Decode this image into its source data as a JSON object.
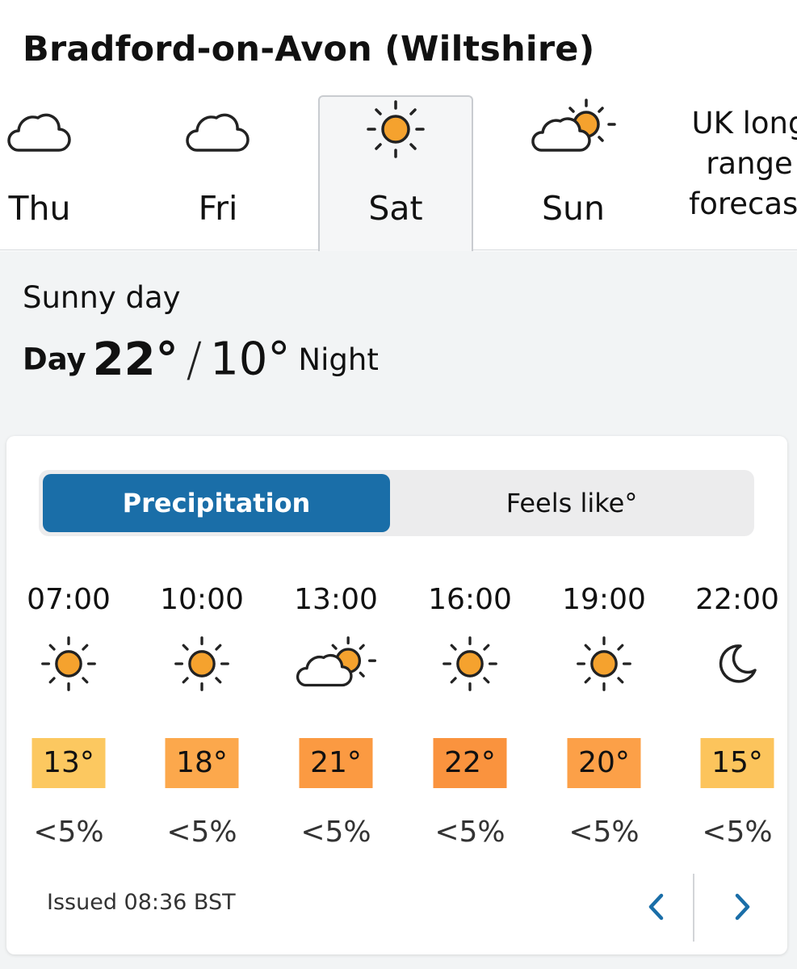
{
  "location": "Bradford-on-Avon (Wiltshire)",
  "days": [
    {
      "label": "Thu",
      "icon": "cloud-icon",
      "selected": false
    },
    {
      "label": "Fri",
      "icon": "cloud-icon",
      "selected": false
    },
    {
      "label": "Sat",
      "icon": "sun-icon",
      "selected": true
    },
    {
      "label": "Sun",
      "icon": "sun-cloud-icon",
      "selected": false
    }
  ],
  "long_range": {
    "line1": "UK long",
    "line2": "range",
    "line3": "forecast"
  },
  "summary": {
    "description": "Sunny day",
    "day_label": "Day",
    "day_temp": "22°",
    "separator": "/",
    "night_temp": "10°",
    "night_label": "Night"
  },
  "toggle": {
    "precipitation": "Precipitation",
    "feels_like": "Feels like°",
    "active": "precipitation"
  },
  "hours": [
    {
      "time": "07:00",
      "icon": "sun-icon",
      "temp": "13°",
      "temp_color": "#fcc860",
      "precip": "<5%"
    },
    {
      "time": "10:00",
      "icon": "sun-icon",
      "temp": "18°",
      "temp_color": "#fca84c",
      "precip": "<5%"
    },
    {
      "time": "13:00",
      "icon": "sun-cloud-icon",
      "temp": "21°",
      "temp_color": "#fb9a42",
      "precip": "<5%"
    },
    {
      "time": "16:00",
      "icon": "sun-icon",
      "temp": "22°",
      "temp_color": "#fa933e",
      "precip": "<5%"
    },
    {
      "time": "19:00",
      "icon": "sun-icon",
      "temp": "20°",
      "temp_color": "#fca048",
      "precip": "<5%"
    },
    {
      "time": "22:00",
      "icon": "moon-icon",
      "temp": "15°",
      "temp_color": "#fcc45c",
      "precip": "<5%"
    }
  ],
  "issued": "Issued 08:36 BST",
  "colors": {
    "accent": "#1a6ea8",
    "sun": "#f5a22e",
    "background": "#f2f4f5"
  }
}
